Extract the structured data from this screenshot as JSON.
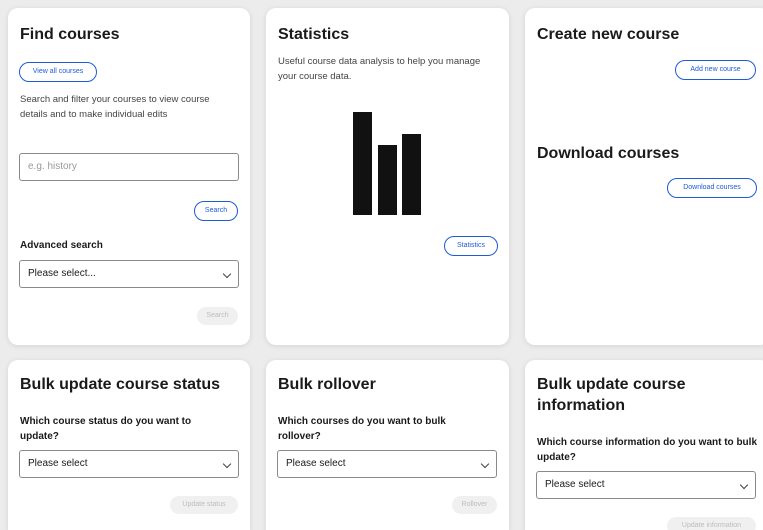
{
  "find_courses": {
    "title": "Find courses",
    "view_all_label": "View all courses",
    "description": "Search and filter your courses to view course details and to make individual edits",
    "search_placeholder": "e.g. history",
    "search_label": "Search",
    "advanced_label": "Advanced search",
    "advanced_select_value": "Please select...",
    "advanced_search_label": "Search"
  },
  "statistics": {
    "title": "Statistics",
    "description": "Useful course data analysis to help you manage your course data.",
    "icon": "bar-chart-icon",
    "button_label": "Statistics"
  },
  "create_course": {
    "title": "Create new course",
    "button_label": "Add new course"
  },
  "download_courses": {
    "title": "Download courses",
    "button_label": "Download courses"
  },
  "bulk_status": {
    "title": "Bulk update course status",
    "question": "Which course status do you want to update?",
    "select_value": "Please select",
    "button_label": "Update status"
  },
  "bulk_rollover": {
    "title": "Bulk rollover",
    "question": "Which courses do you want to bulk rollover?",
    "select_value": "Please select",
    "button_label": "Rollover"
  },
  "bulk_info": {
    "title": "Bulk update course information",
    "question": "Which course information do you want to bulk update?",
    "select_value": "Please select",
    "button_label": "Update information"
  },
  "colors": {
    "accent": "#1f5bd6",
    "background": "#ececec",
    "card": "#ffffff",
    "disabled_bg": "#f0f0f0",
    "disabled_text": "#bcbcbc"
  }
}
